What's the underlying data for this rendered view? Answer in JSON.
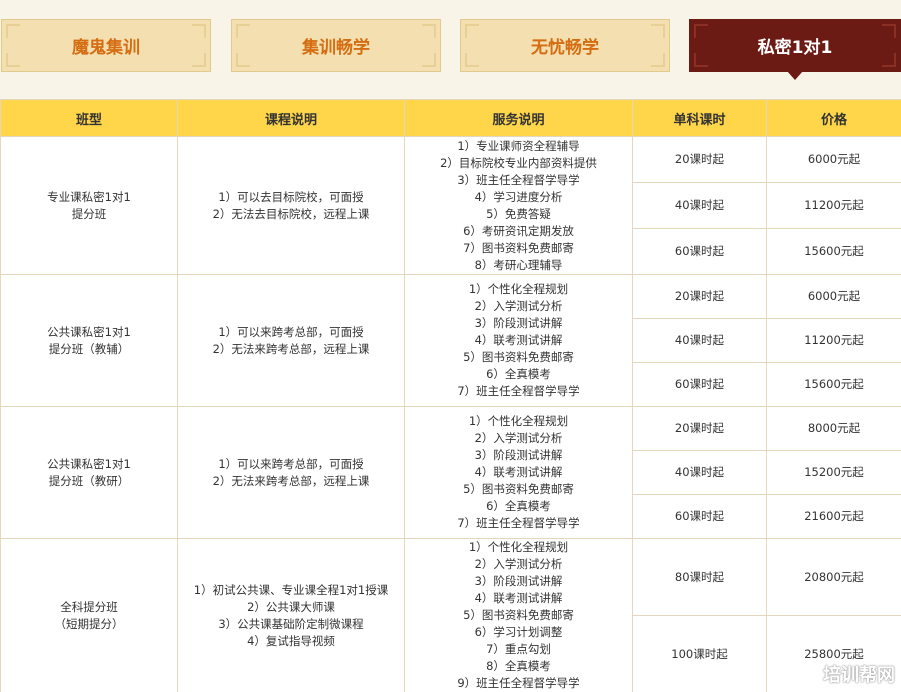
{
  "tabs": [
    {
      "label": "魔鬼集训",
      "active": false
    },
    {
      "label": "集训畅学",
      "active": false
    },
    {
      "label": "无忧畅学",
      "active": false
    },
    {
      "label": "私密1对1",
      "active": true
    }
  ],
  "table": {
    "headers": {
      "class_type": "班型",
      "course_desc": "课程说明",
      "service_desc": "服务说明",
      "hours": "单科课时",
      "price": "价格"
    },
    "groups": [
      {
        "class_type": [
          "专业课私密1对1",
          "提分班"
        ],
        "course_desc": [
          "1）可以去目标院校，可面授",
          "2）无法去目标院校，远程上课"
        ],
        "service_desc": [
          "1）专业课师资全程辅导",
          "2）目标院校专业内部资料提供",
          "3）班主任全程督学导学",
          "4）学习进度分析",
          "5）免费答疑",
          "6）考研资讯定期发放",
          "7）图书资料免费邮寄",
          "8）考研心理辅导"
        ],
        "rows": [
          {
            "hours": "20课时起",
            "price": "6000元起"
          },
          {
            "hours": "40课时起",
            "price": "11200元起"
          },
          {
            "hours": "60课时起",
            "price": "15600元起"
          }
        ]
      },
      {
        "class_type": [
          "公共课私密1对1",
          "提分班（教辅）"
        ],
        "course_desc": [
          "1）可以来跨考总部，可面授",
          "2）无法来跨考总部，远程上课"
        ],
        "service_desc": [
          "1）个性化全程规划",
          "2）入学测试分析",
          "3）阶段测试讲解",
          "4）联考测试讲解",
          "5）图书资料免费邮寄",
          "6）全真模考",
          "7）班主任全程督学导学"
        ],
        "rows": [
          {
            "hours": "20课时起",
            "price": "6000元起"
          },
          {
            "hours": "40课时起",
            "price": "11200元起"
          },
          {
            "hours": "60课时起",
            "price": "15600元起"
          }
        ]
      },
      {
        "class_type": [
          "公共课私密1对1",
          "提分班（教研）"
        ],
        "course_desc": [
          "1）可以来跨考总部，可面授",
          "2）无法来跨考总部，远程上课"
        ],
        "service_desc": [
          "1）个性化全程规划",
          "2）入学测试分析",
          "3）阶段测试讲解",
          "4）联考测试讲解",
          "5）图书资料免费邮寄",
          "6）全真模考",
          "7）班主任全程督学导学"
        ],
        "rows": [
          {
            "hours": "20课时起",
            "price": "8000元起"
          },
          {
            "hours": "40课时起",
            "price": "15200元起"
          },
          {
            "hours": "60课时起",
            "price": "21600元起"
          }
        ]
      },
      {
        "class_type": [
          "全科提分班",
          "（短期提分）"
        ],
        "course_desc": [
          "1）初试公共课、专业课全程1对1授课",
          "2）公共课大师课",
          "3）公共课基础阶定制微课程",
          "4）复试指导视频"
        ],
        "service_desc": [
          "1）个性化全程规划",
          "2）入学测试分析",
          "3）阶段测试讲解",
          "4）联考测试讲解",
          "5）图书资料免费邮寄",
          "6）学习计划调整",
          "7）重点勾划",
          "8）全真模考",
          "9）班主任全程督学导学"
        ],
        "rows": [
          {
            "hours": "80课时起",
            "price": "20800元起"
          },
          {
            "hours": "100课时起",
            "price": "25800元起"
          }
        ]
      }
    ]
  },
  "watermark": {
    "text": "培训帮网",
    "icon": "tree-logo-icon"
  },
  "colors": {
    "header_yellow": "#ffd54a",
    "active_tab": "#6b1a14",
    "tab_bg": "#f3dfb0",
    "tab_text": "#d56d12",
    "border": "#e3d7bd"
  }
}
